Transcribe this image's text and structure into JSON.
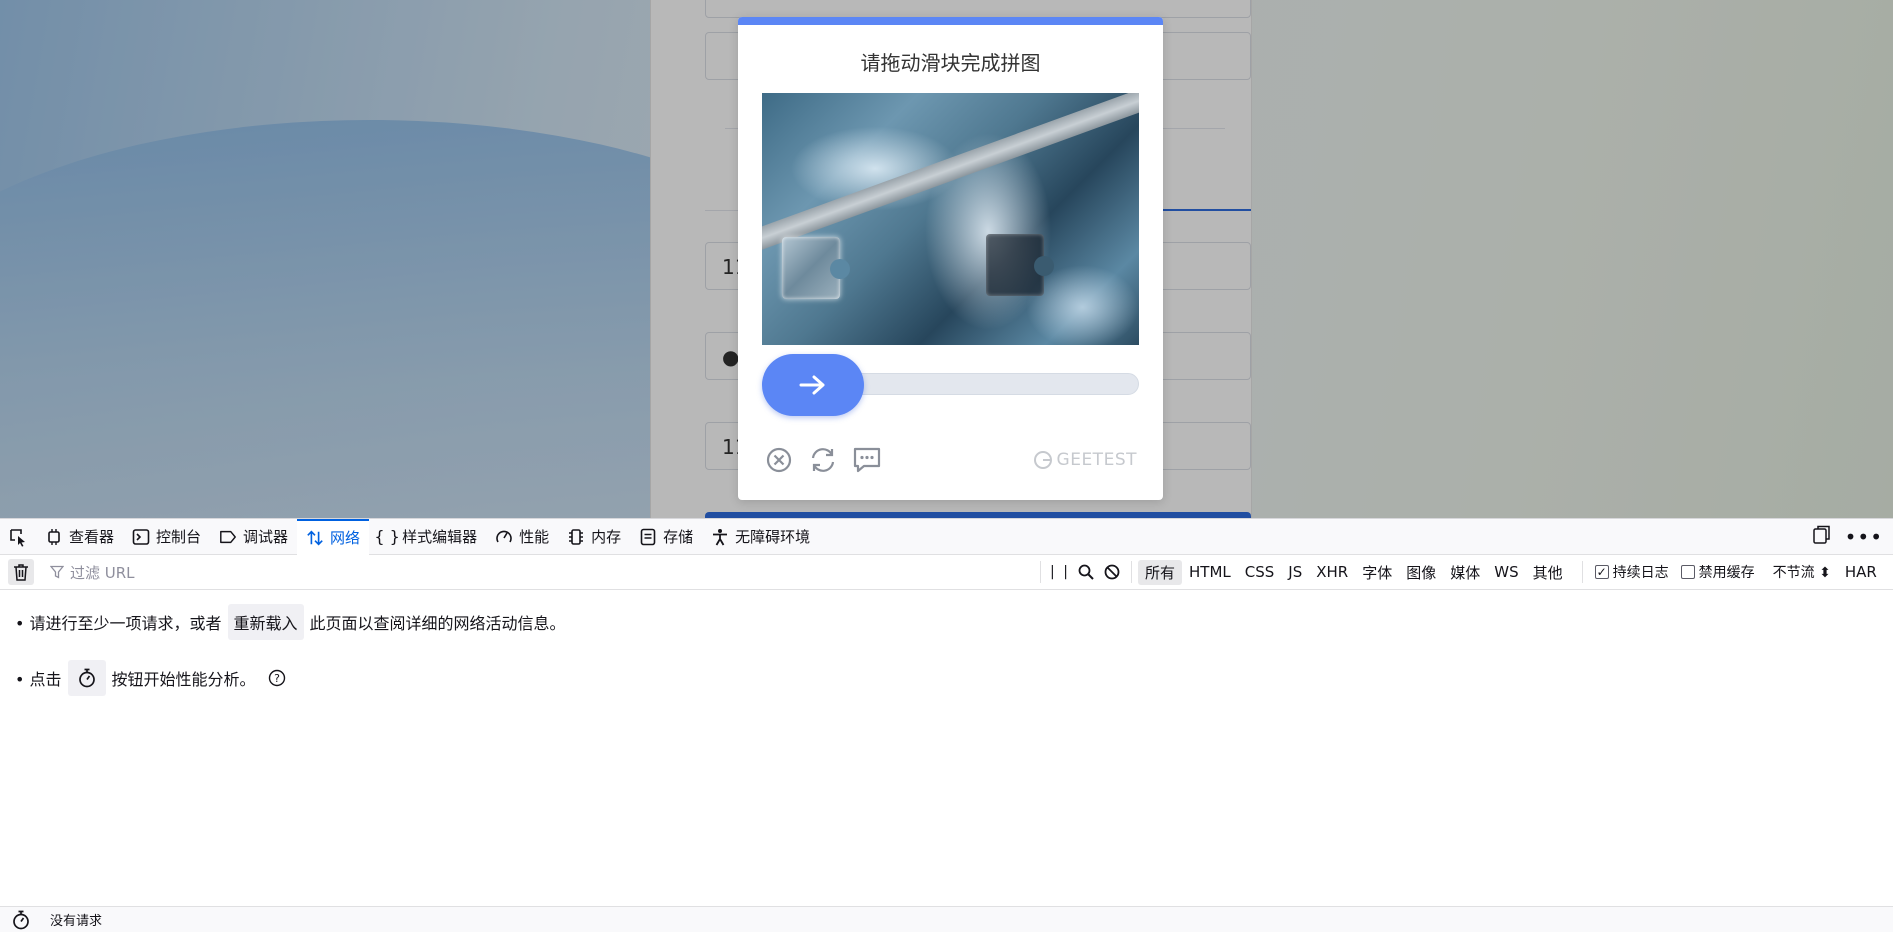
{
  "page": {
    "field_partial_1": "11",
    "field_partial_2": "●●",
    "field_partial_3": "11"
  },
  "captcha": {
    "title": "请拖动滑块完成拼图",
    "brand": "GEETEST",
    "accent": "#5b86f5",
    "icons": [
      "close-circle-icon",
      "refresh-icon",
      "feedback-icon"
    ]
  },
  "devtools": {
    "tabs": [
      {
        "label": "查看器",
        "icon": "inspector-icon"
      },
      {
        "label": "控制台",
        "icon": "console-icon"
      },
      {
        "label": "调试器",
        "icon": "debugger-icon"
      },
      {
        "label": "网络",
        "icon": "network-icon",
        "active": true
      },
      {
        "label": "样式编辑器",
        "icon": "style-editor-icon"
      },
      {
        "label": "性能",
        "icon": "performance-icon"
      },
      {
        "label": "内存",
        "icon": "memory-icon"
      },
      {
        "label": "存储",
        "icon": "storage-icon"
      },
      {
        "label": "无障碍环境",
        "icon": "accessibility-icon"
      }
    ],
    "filter_placeholder": "过滤 URL",
    "type_filters": [
      "所有",
      "HTML",
      "CSS",
      "JS",
      "XHR",
      "字体",
      "图像",
      "媒体",
      "WS",
      "其他"
    ],
    "persist_logs": {
      "label": "持续日志",
      "checked": true
    },
    "disable_cache": {
      "label": "禁用缓存",
      "checked": false
    },
    "throttle": "不节流 ⬍",
    "har": "HAR",
    "hint1_pre": "• 请进行至少一项请求，或者",
    "hint1_button": "重新载入",
    "hint1_post": "此页面以查阅详细的网络活动信息。",
    "hint2_pre": "• 点击",
    "hint2_post": "按钮开始性能分析。",
    "status": "没有请求"
  }
}
